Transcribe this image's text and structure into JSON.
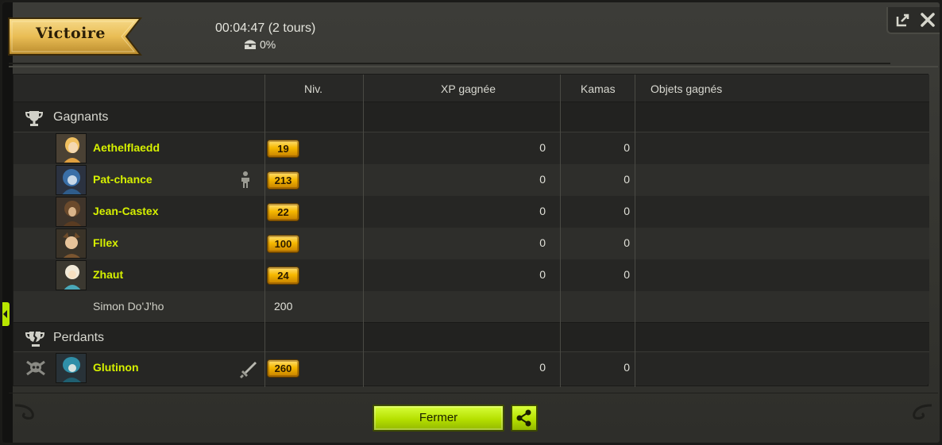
{
  "window": {
    "result_title": "Victoire",
    "duration": "00:04:47 (2 tours)",
    "bonus_value": "0%",
    "popout_icon": "popout-icon",
    "close_icon": "close-icon"
  },
  "columns": {
    "level": "Niv.",
    "xp": "XP gagnée",
    "kamas": "Kamas",
    "items": "Objets gagnés"
  },
  "winners": {
    "label": "Gagnants",
    "icon": "trophy-icon",
    "players": [
      {
        "name": "Aethelflaedd",
        "level": "19",
        "xp": "0",
        "kamas": "0"
      },
      {
        "name": "Pat-chance",
        "level": "213",
        "xp": "0",
        "kamas": "0",
        "status_icon": "person-icon"
      },
      {
        "name": "Jean-Castex",
        "level": "22",
        "xp": "0",
        "kamas": "0"
      },
      {
        "name": "Fllex",
        "level": "100",
        "xp": "0",
        "kamas": "0"
      },
      {
        "name": "Zhaut",
        "level": "24",
        "xp": "0",
        "kamas": "0"
      }
    ],
    "monster": {
      "name": "Simon Do'J'ho",
      "level": "200"
    }
  },
  "losers": {
    "label": "Perdants",
    "icon": "broken-trophy-icon",
    "players": [
      {
        "name": "Glutinon",
        "level": "260",
        "xp": "0",
        "kamas": "0",
        "status_icon": "sword-icon",
        "dead_icon": "skull-crossbones-icon"
      }
    ]
  },
  "footer": {
    "close_label": "Fermer",
    "share_icon": "share-icon"
  },
  "colors": {
    "accent_green": "#b5e000",
    "name_yellow": "#d6f000",
    "badge_gold": "#f6b800"
  }
}
